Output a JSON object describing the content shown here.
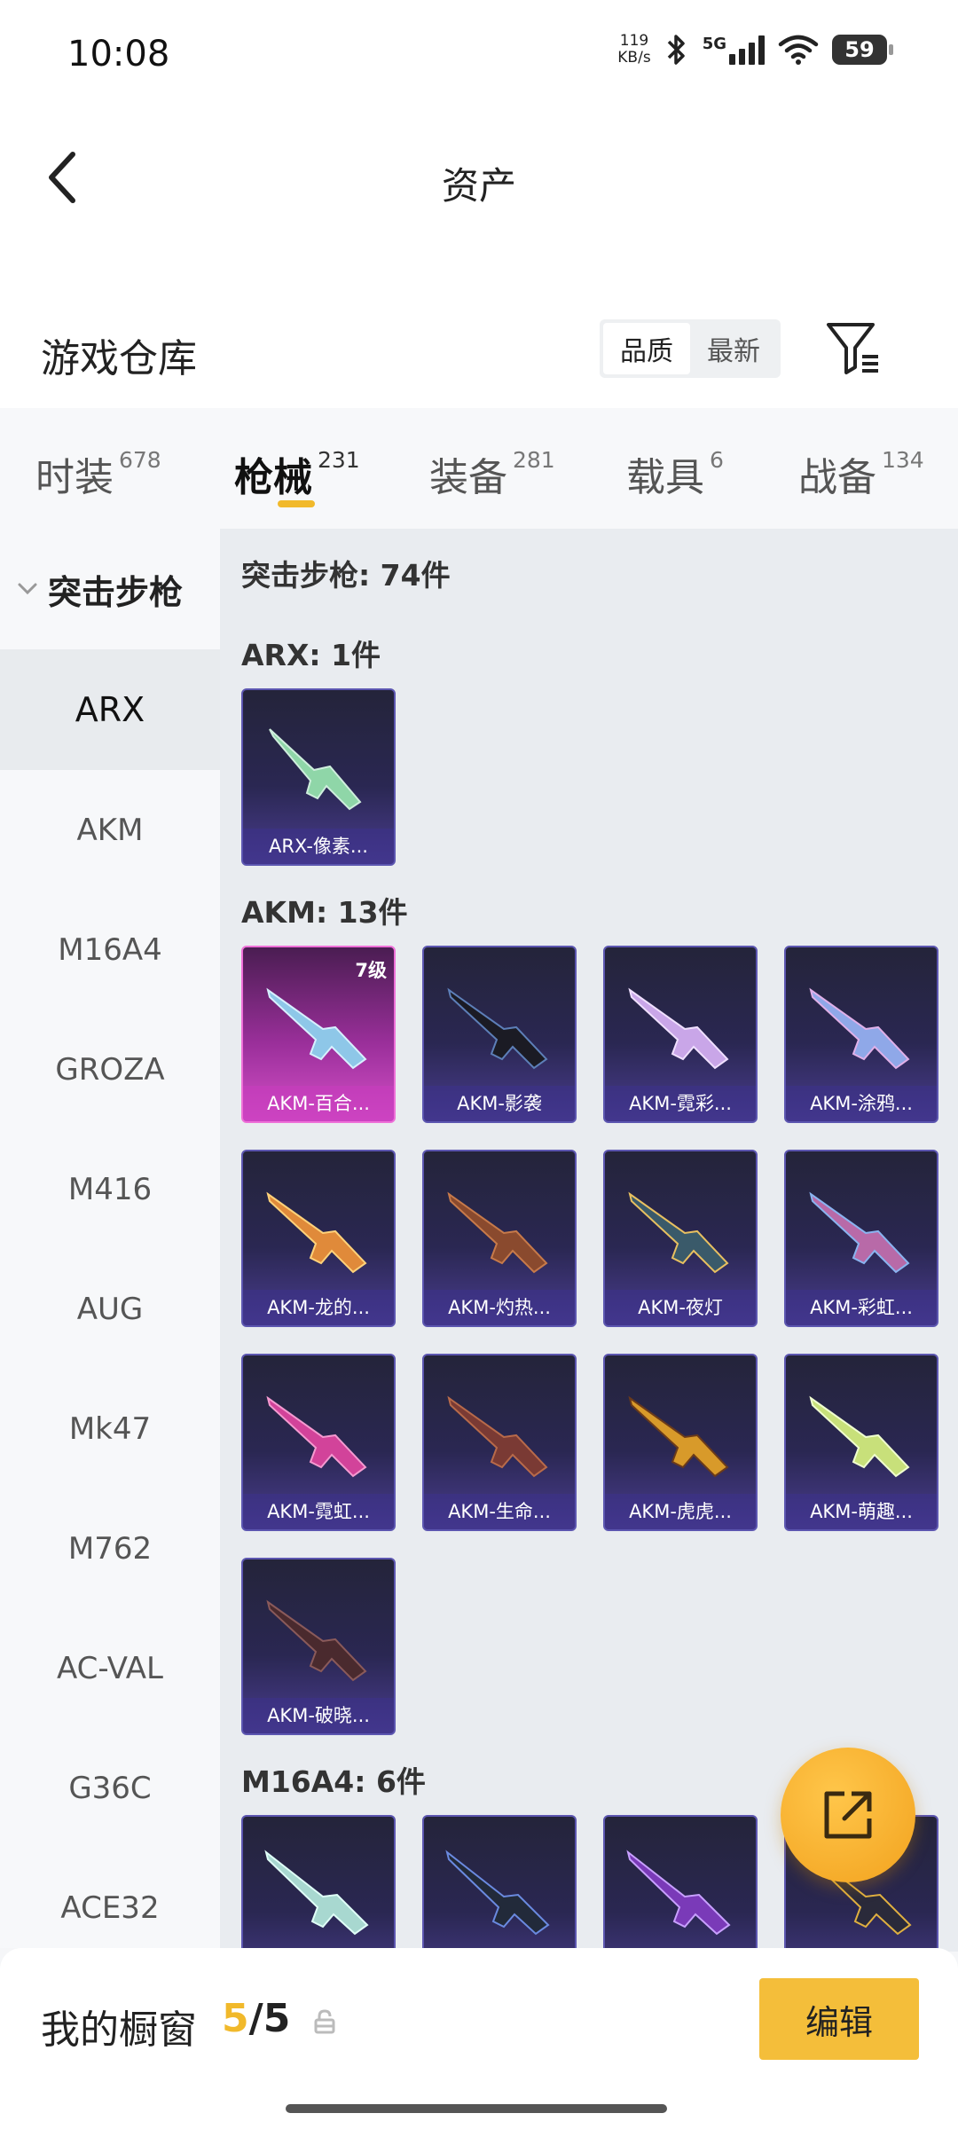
{
  "status_bar": {
    "time": "10:08",
    "net_speed_value": "119",
    "net_speed_unit": "KB/s",
    "network": "5G",
    "battery": "59",
    "icons": [
      "bluetooth-icon",
      "signal-icon",
      "wifi-icon",
      "battery-icon"
    ]
  },
  "header": {
    "title": "资产",
    "back_icon": "chevron-left-icon"
  },
  "warehouse": {
    "title": "游戏仓库",
    "sort_options": [
      "品质",
      "最新"
    ],
    "sort_selected": "品质",
    "filter_icon": "filter-icon"
  },
  "tabs": [
    {
      "label": "时装",
      "count": "678"
    },
    {
      "label": "枪械",
      "count": "231"
    },
    {
      "label": "装备",
      "count": "281"
    },
    {
      "label": "载具",
      "count": "6"
    },
    {
      "label": "战备",
      "count": "134"
    }
  ],
  "active_tab": "枪械",
  "sidebar": {
    "group_label": "突击步枪",
    "items": [
      "ARX",
      "AKM",
      "M16A4",
      "GROZA",
      "M416",
      "AUG",
      "Mk47",
      "M762",
      "AC-VAL",
      "G36C",
      "ACE32"
    ],
    "active_item": "ARX"
  },
  "content": {
    "category_total": "突击步枪: 74件",
    "sections": [
      {
        "title": "ARX: 1件",
        "items": [
          {
            "name": "ARX-像素...",
            "level": ""
          }
        ]
      },
      {
        "title": "AKM: 13件",
        "items": [
          {
            "name": "AKM-百合...",
            "level": "7级"
          },
          {
            "name": "AKM-影袭",
            "level": ""
          },
          {
            "name": "AKM-霓彩...",
            "level": ""
          },
          {
            "name": "AKM-涂鸦...",
            "level": ""
          },
          {
            "name": "AKM-龙的...",
            "level": ""
          },
          {
            "name": "AKM-灼热...",
            "level": ""
          },
          {
            "name": "AKM-夜灯",
            "level": ""
          },
          {
            "name": "AKM-彩虹...",
            "level": ""
          },
          {
            "name": "AKM-霓虹...",
            "level": ""
          },
          {
            "name": "AKM-生命...",
            "level": ""
          },
          {
            "name": "AKM-虎虎...",
            "level": ""
          },
          {
            "name": "AKM-萌趣...",
            "level": ""
          },
          {
            "name": "AKM-破晓...",
            "level": ""
          }
        ]
      },
      {
        "title": "M16A4: 6件",
        "items": []
      }
    ]
  },
  "fab": {
    "icon": "share-external-icon"
  },
  "bottom_bar": {
    "title": "我的橱窗",
    "count_current": "5",
    "count_separator": "/",
    "count_max": "5",
    "lock_icon": "lock-icon",
    "edit_label": "编辑"
  },
  "colors": {
    "accent": "#f1b92b",
    "card_purple": "#2a2752",
    "card_pink": "#d44fc7"
  }
}
